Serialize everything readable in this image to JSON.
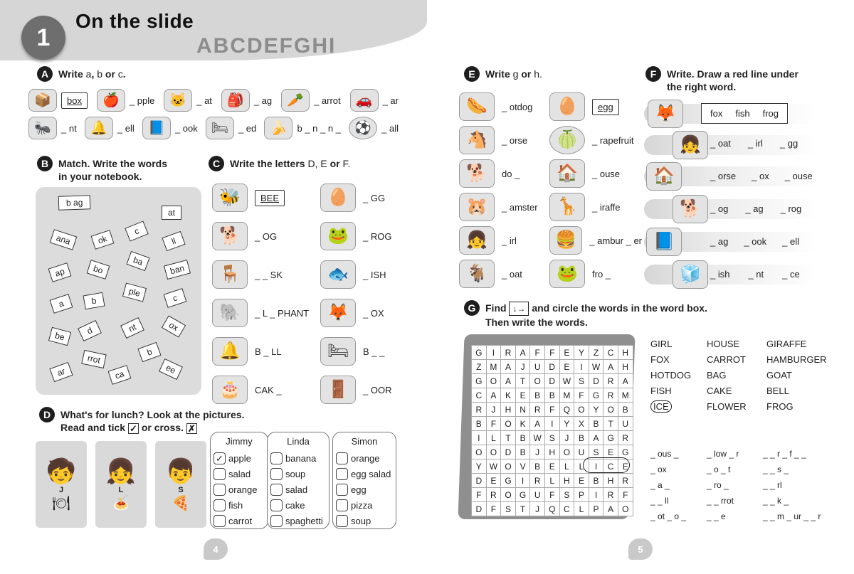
{
  "header": {
    "number": "1",
    "title": "On the slide",
    "letters": "ABCDEFGHI"
  },
  "secA": {
    "letter": "A",
    "title_pre": "Write ",
    "title_a": "a",
    "title_sep": ", ",
    "title_b": "b",
    "title_or": " or ",
    "title_c": "c",
    "title_end": ".",
    "row1": [
      {
        "icon": "📦",
        "text": "box",
        "boxed": true
      },
      {
        "icon": "🍎",
        "text": "_ pple"
      },
      {
        "icon": "🐱",
        "text": "_ at"
      },
      {
        "icon": "🎒",
        "text": "_ ag"
      },
      {
        "icon": "🥕",
        "text": "_ arrot"
      },
      {
        "icon": "🚗",
        "text": "_ ar"
      }
    ],
    "row2": [
      {
        "icon": "🐜",
        "text": "_ nt"
      },
      {
        "icon": "🔔",
        "text": "_ ell"
      },
      {
        "icon": "📘",
        "text": "_ ook"
      },
      {
        "icon": "🛏",
        "text": "_ ed"
      },
      {
        "icon": "🍌",
        "text": "b _ n _ n _"
      },
      {
        "icon": "⚽",
        "text": "_ all"
      }
    ]
  },
  "secB": {
    "letter": "B",
    "title1": "Match. Write the words",
    "title2": "in your notebook.",
    "example": "b ag",
    "cards": [
      "at",
      "ana",
      "ok",
      "c",
      "ll",
      "ap",
      "bo",
      "ba",
      "ban",
      "a",
      "b",
      "ple",
      "c",
      "be",
      "d",
      "nt",
      "ox",
      "rrot",
      "b",
      "ar",
      "ca",
      "ee"
    ]
  },
  "secC": {
    "letter": "C",
    "title": "Write the letters",
    "letters": "D, E",
    "or": "or",
    "last": "F.",
    "example": "BEE",
    "left": [
      {
        "icon": "🐝",
        "text": "BEE"
      },
      {
        "icon": "🐕",
        "text": "_ OG"
      },
      {
        "icon": "🪑",
        "text": "_ _ SK"
      },
      {
        "icon": "🐘",
        "text": "_ L _ PHANT"
      },
      {
        "icon": "🔔",
        "text": "B _ LL"
      },
      {
        "icon": "🎂",
        "text": "CAK _"
      }
    ],
    "right": [
      {
        "icon": "🥚",
        "text": "_ GG"
      },
      {
        "icon": "🐸",
        "text": "_ ROG"
      },
      {
        "icon": "🐟",
        "text": "_ ISH"
      },
      {
        "icon": "🦊",
        "text": "_ OX"
      },
      {
        "icon": "🛏",
        "text": "B _ _"
      },
      {
        "icon": "🚪",
        "text": "_ OOR"
      }
    ]
  },
  "secD": {
    "letter": "D",
    "title1": "What's for lunch? Look at the pictures.",
    "title2": "Read and tick",
    "title3": "or cross.",
    "tick": "✓",
    "cross": "✗",
    "kids": [
      {
        "name": "J",
        "icon": "🧒"
      },
      {
        "name": "L",
        "icon": "👧"
      },
      {
        "name": "S",
        "icon": "👦"
      }
    ],
    "columns": [
      {
        "name": "Jimmy",
        "items": [
          "apple",
          "salad",
          "orange",
          "fish",
          "carrot"
        ],
        "checked": 0
      },
      {
        "name": "Linda",
        "items": [
          "banana",
          "soup",
          "salad",
          "cake",
          "spaghetti"
        ],
        "checked": -1
      },
      {
        "name": "Simon",
        "items": [
          "orange",
          "egg salad",
          "egg",
          "pizza",
          "soup"
        ],
        "checked": -1
      }
    ]
  },
  "secE": {
    "letter": "E",
    "title_pre": "Write",
    "title_g": "g",
    "title_or": "or",
    "title_h": "h.",
    "left": [
      {
        "icon": "🌭",
        "text": "_ otdog"
      },
      {
        "icon": "🐴",
        "text": "_ orse"
      },
      {
        "icon": "🐕",
        "text": "do _"
      },
      {
        "icon": "🐹",
        "text": "_ amster"
      },
      {
        "icon": "👧",
        "text": "_ irl"
      },
      {
        "icon": "🐐",
        "text": "_ oat"
      }
    ],
    "right": [
      {
        "icon": "🥚",
        "text": "egg",
        "boxed": true
      },
      {
        "icon": "🍈",
        "text": "_ rapefruit"
      },
      {
        "icon": "🏠",
        "text": "_ ouse"
      },
      {
        "icon": "🦒",
        "text": "_ iraffe"
      },
      {
        "icon": "🍔",
        "text": "_ ambur _ er"
      },
      {
        "icon": "🐸",
        "text": "fro _"
      }
    ]
  },
  "secF": {
    "letter": "F",
    "title1": "Write. Draw a red line under",
    "title2": "the right word.",
    "rows": [
      {
        "icon": "🦊",
        "opts": [
          "fox",
          "fish",
          "frog"
        ],
        "example": true
      },
      {
        "icon": "👧",
        "opts": [
          "_ oat",
          "_ irl",
          "_ gg"
        ]
      },
      {
        "icon": "🏠",
        "opts": [
          "_ orse",
          "_ ox",
          "_ ouse"
        ]
      },
      {
        "icon": "🐕",
        "opts": [
          "_ og",
          "_ ag",
          "_ rog"
        ]
      },
      {
        "icon": "📘",
        "opts": [
          "_ ag",
          "_ ook",
          "_ ell"
        ]
      },
      {
        "icon": "🧊",
        "opts": [
          "_ ish",
          "_ nt",
          "_ ce"
        ]
      }
    ]
  },
  "secG": {
    "letter": "G",
    "title1": "Find",
    "arrows": "↓→",
    "title2": "and circle the words in the word box.",
    "title3": "Then write the words.",
    "grid": [
      "GIRAFFEYZCH",
      "ZMAJUDEIWAH",
      "GOATODWSDRA",
      "CAKEBBMFGRM",
      "RJHNRFQOYOB",
      "BFOKAIYXBTU",
      "ILTBWSJBAGR",
      "OODBJHOUSEG",
      "YWOVBELLICE",
      "DEGIRLHEBHR",
      "FROGUFSPIRF",
      "DFSTJQCLPAO"
    ],
    "words": [
      [
        "GIRL",
        "HOUSE",
        "GIRAFFE"
      ],
      [
        "FOX",
        "CARROT",
        "HAMBURGER"
      ],
      [
        "HOTDOG",
        "BAG",
        "GOAT"
      ],
      [
        "FISH",
        "CAKE",
        "BELL"
      ],
      [
        "ICE",
        "FLOWER",
        "FROG"
      ]
    ],
    "blanks": [
      [
        "_ ous _",
        "_ low _ r",
        "_ _ r _ f _ _"
      ],
      [
        "_ ox",
        "_ o _ t",
        "_ _ s _"
      ],
      [
        "_ a _",
        "_ ro _",
        "_ _ rl"
      ],
      [
        "_ _ ll",
        "_ _ rrot",
        "_ _ k _"
      ],
      [
        "_ ot _ o _",
        "_ _ e",
        "_ _ m _ ur _ _ r"
      ]
    ]
  },
  "pages": {
    "left": "4",
    "right": "5"
  }
}
